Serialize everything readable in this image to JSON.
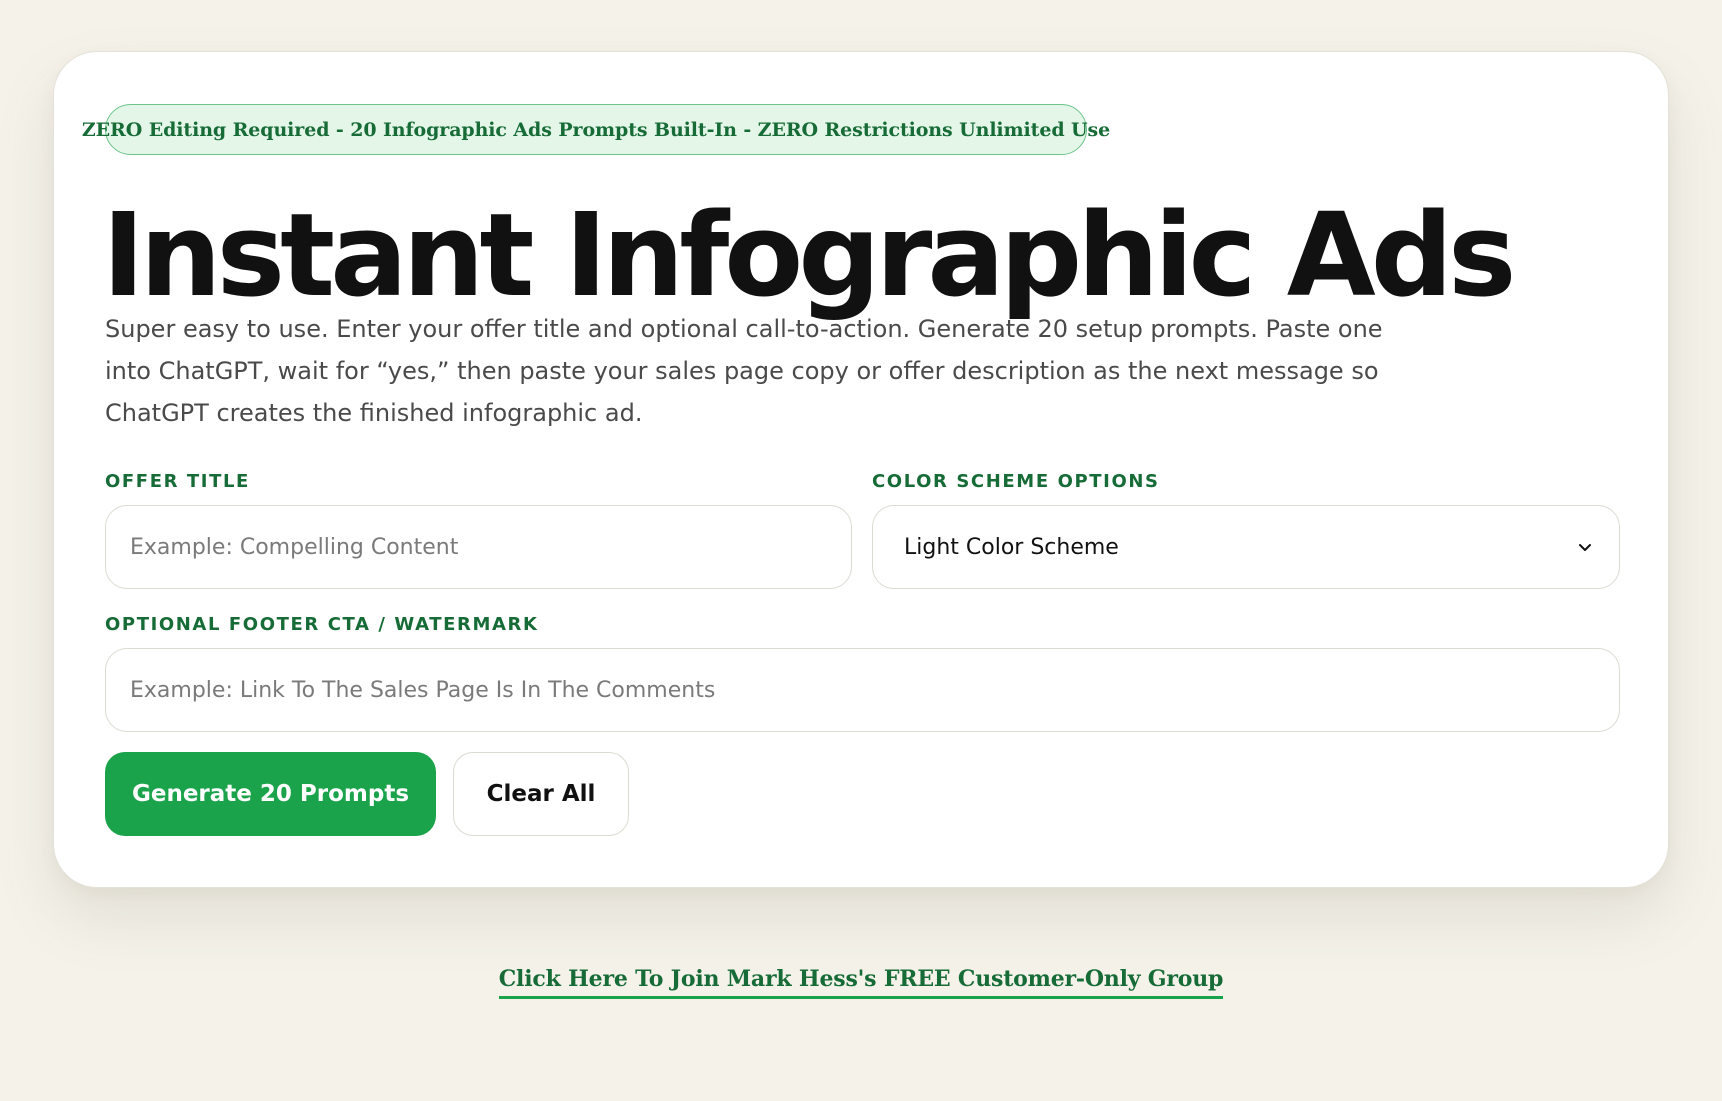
{
  "badge": {
    "text": "ZERO Editing Required - 20 Infographic Ads Prompts Built-In - ZERO Restrictions Unlimited Use"
  },
  "page": {
    "title": "Instant Infographic Ads",
    "description": "Super easy to use. Enter your offer title and optional call-to-action. Generate 20 setup prompts. Paste one into ChatGPT, wait for “yes,” then paste your sales page copy or offer description as the next message so ChatGPT creates the finished infographic ad."
  },
  "form": {
    "offer_title": {
      "label": "OFFER TITLE",
      "placeholder": "Example: Compelling Content",
      "value": ""
    },
    "color_scheme": {
      "label": "COLOR SCHEME OPTIONS",
      "selected": "Light Color Scheme",
      "icon": "chevron-down-icon"
    },
    "footer_cta": {
      "label": "OPTIONAL FOOTER CTA / WATERMARK",
      "placeholder": "Example: Link To The Sales Page Is In The Comments",
      "value": ""
    }
  },
  "actions": {
    "generate_label": "Generate 20 Prompts",
    "clear_label": "Clear All"
  },
  "footer": {
    "link_text": "Click Here To Join Mark Hess's FREE Customer-Only Group"
  },
  "colors": {
    "accent_green": "#1aa34a",
    "label_green": "#166b36",
    "badge_bg": "#e3f6e8",
    "page_bg": "#f5f2ea"
  }
}
